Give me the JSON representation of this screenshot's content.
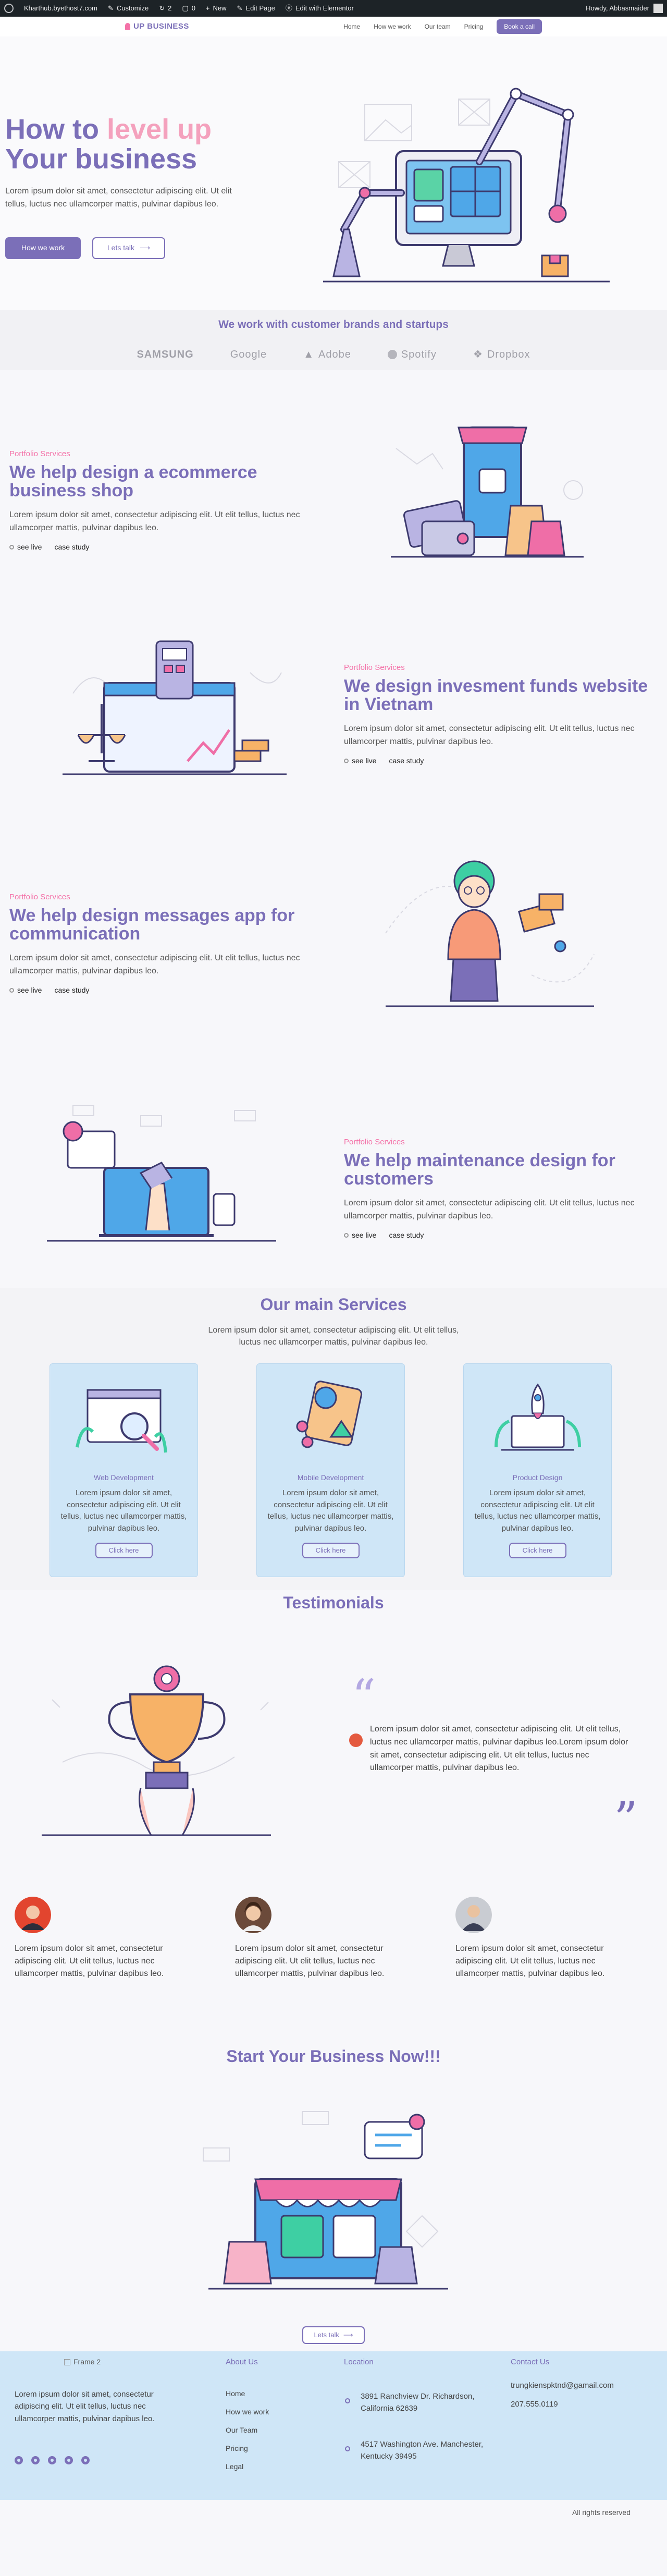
{
  "admin_bar": {
    "site": "Kharthub.byethost7.com",
    "customize": "Customize",
    "comments": "0",
    "updates": "2",
    "new": "New",
    "edit_page": "Edit Page",
    "elementor": "Edit with Elementor",
    "howdy": "Howdy, Abbasmaider"
  },
  "header": {
    "logo": "UP BUSINESS",
    "nav": [
      "Home",
      "How we work",
      "Our team",
      "Pricing"
    ],
    "cta": "Book a call"
  },
  "hero": {
    "title_1": "How to ",
    "title_highlight": "level up",
    "title_2": "Your business",
    "subtitle": "Lorem ipsum dolor sit amet, consectetur adipiscing elit. Ut elit tellus, luctus nec ullamcorper mattis, pulvinar dapibus leo.",
    "primary_button": "How we work",
    "secondary_button": "Lets talk"
  },
  "brands": {
    "title": "We work with customer brands and startups",
    "logos": [
      "SAMSUNG",
      "Google",
      "Adobe",
      "Spotify",
      "Dropbox"
    ]
  },
  "portfolio": [
    {
      "eyebrow": "Portfolio Services",
      "title": "We help design a ecommerce business shop",
      "desc": "Lorem ipsum dolor sit amet, consectetur adipiscing elit. Ut elit tellus, luctus nec ullamcorper mattis, pulvinar dapibus leo.",
      "link1": "see live",
      "link2": "case study"
    },
    {
      "eyebrow": "Portfolio Services",
      "title": "We design invesment funds website in Vietnam",
      "desc": "Lorem ipsum dolor sit amet, consectetur adipiscing elit. Ut elit tellus, luctus nec ullamcorper mattis, pulvinar dapibus leo.",
      "link1": "see live",
      "link2": "case study"
    },
    {
      "eyebrow": "Portfolio Services",
      "title": "We help design messages app for communication",
      "desc": "Lorem ipsum dolor sit amet, consectetur adipiscing elit. Ut elit tellus, luctus nec ullamcorper mattis, pulvinar dapibus leo.",
      "link1": "see live",
      "link2": "case study"
    },
    {
      "eyebrow": "Portfolio Services",
      "title": "We help maintenance design for customers",
      "desc": "Lorem ipsum dolor sit amet, consectetur adipiscing elit. Ut elit tellus, luctus nec ullamcorper mattis, pulvinar dapibus leo.",
      "link1": "see live",
      "link2": "case study"
    }
  ],
  "services": {
    "title": "Our main Services",
    "subtitle": "Lorem ipsum dolor sit amet, consectetur adipiscing elit. Ut elit tellus, luctus nec ullamcorper mattis, pulvinar dapibus leo.",
    "cards": [
      {
        "title": "Web Development",
        "desc": "Lorem ipsum dolor sit amet, consectetur adipiscing elit. Ut elit tellus, luctus nec ullamcorper mattis, pulvinar dapibus leo.",
        "button": "Click here"
      },
      {
        "title": "Mobile Development",
        "desc": "Lorem ipsum dolor sit amet, consectetur adipiscing elit. Ut elit tellus, luctus nec ullamcorper mattis, pulvinar dapibus leo.",
        "button": "Click here"
      },
      {
        "title": "Product Design",
        "desc": "Lorem ipsum dolor sit amet, consectetur adipiscing elit. Ut elit tellus, luctus nec ullamcorper mattis, pulvinar dapibus leo.",
        "button": "Click here"
      }
    ]
  },
  "testimonials": {
    "title": "Testimonials",
    "featured": "Lorem ipsum dolor sit amet, consectetur adipiscing elit. Ut elit tellus, luctus nec ullamcorper mattis, pulvinar dapibus leo.Lorem ipsum dolor sit amet, consectetur adipiscing elit. Ut elit tellus, luctus nec ullamcorper mattis, pulvinar dapibus leo.",
    "items": [
      {
        "text": "Lorem ipsum dolor sit amet, consectetur adipiscing elit. Ut elit tellus, luctus nec ullamcorper mattis, pulvinar dapibus leo."
      },
      {
        "text": "Lorem ipsum dolor sit amet, consectetur adipiscing elit. Ut elit tellus, luctus nec ullamcorper mattis, pulvinar dapibus leo."
      },
      {
        "text": "Lorem ipsum dolor sit amet, consectetur adipiscing elit. Ut elit tellus, luctus nec ullamcorper mattis, pulvinar dapibus leo."
      }
    ]
  },
  "start": {
    "title": "Start Your Business Now!!!",
    "button": "Lets talk"
  },
  "footer": {
    "logo_alt": "Frame 2",
    "about": "Lorem ipsum dolor sit amet, consectetur adipiscing elit. Ut elit tellus, luctus nec ullamcorper mattis, pulvinar dapibus leo.",
    "about_us_title": "About Us",
    "links": [
      "Home",
      "How we work",
      "Our Team",
      "Pricing",
      "Legal"
    ],
    "location_title": "Location",
    "location_1": "3891 Ranchview Dr. Richardson, California 62639",
    "location_2": "4517 Washington Ave. Manchester, Kentucky 39495",
    "contact_title": "Contact Us",
    "email": "trungkienspktnd@gamail.com",
    "phone": "207.555.0119",
    "copyright": "All rights reserved"
  }
}
